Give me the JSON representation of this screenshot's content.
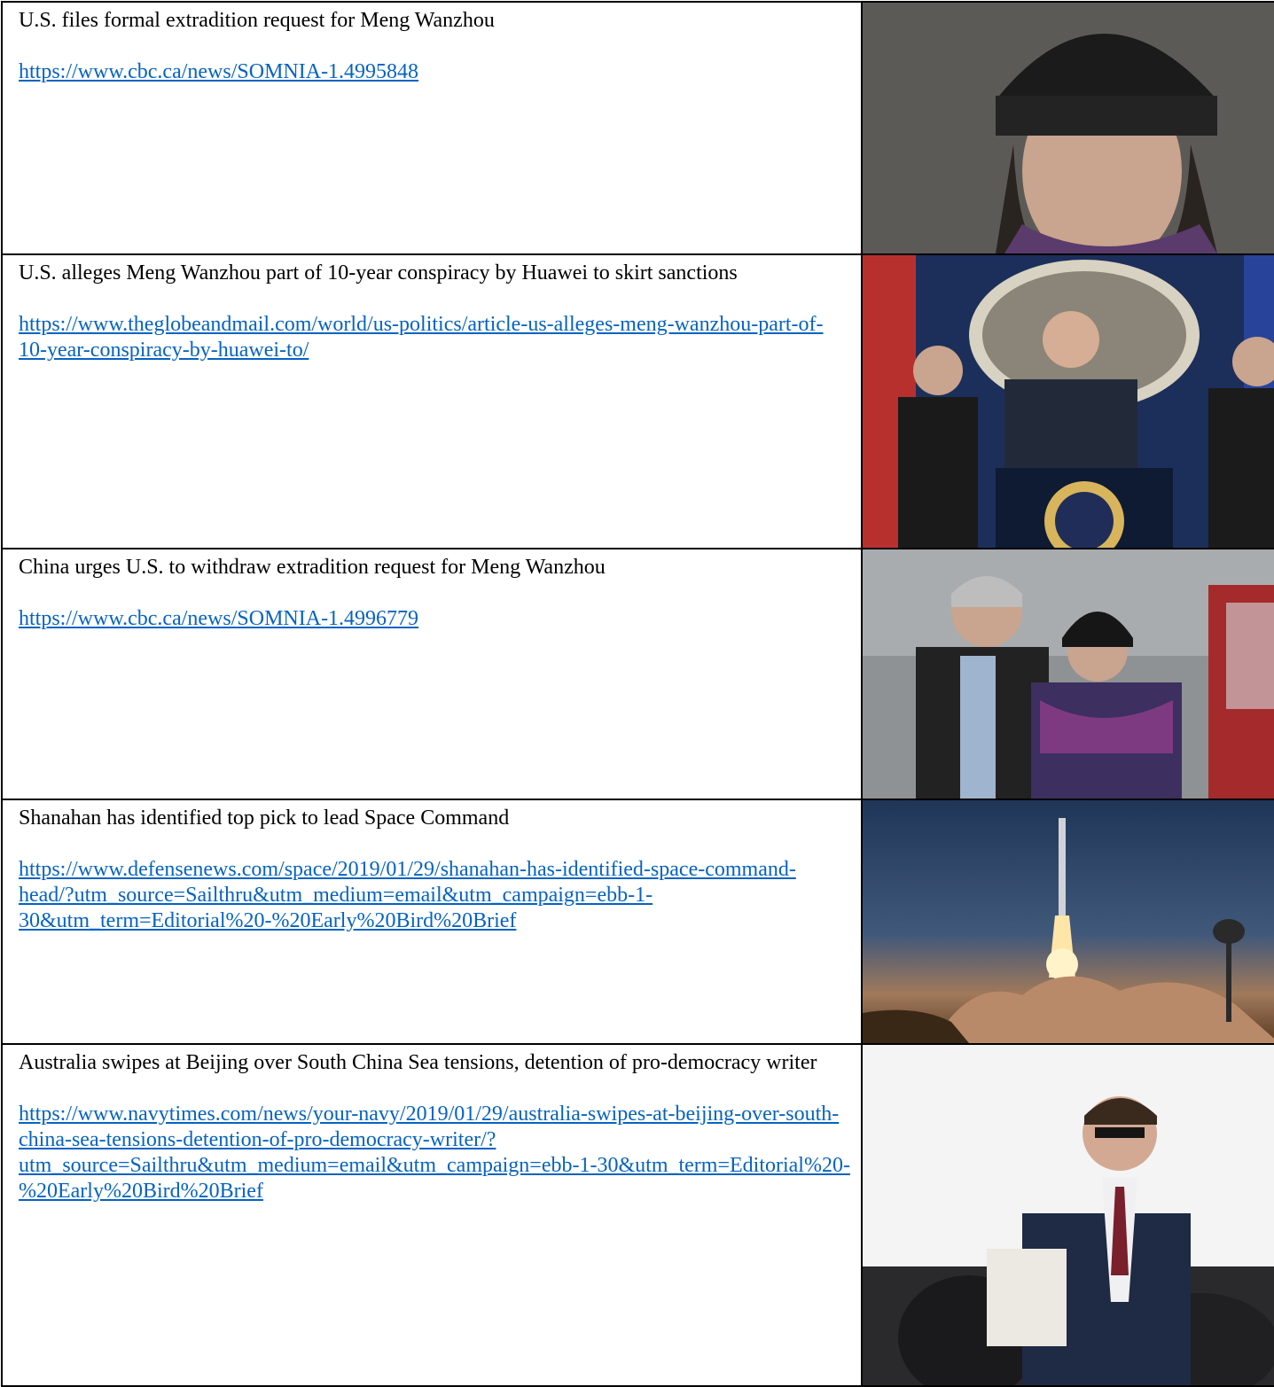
{
  "articles": [
    {
      "headline": "U.S. files formal extradition request for Meng Wanzhou",
      "url": "https://www.cbc.ca/news/SOMNIA-1.4995848",
      "image": "woman-in-knit-hat-photo"
    },
    {
      "headline": "U.S. alleges Meng Wanzhou part of 10-year conspiracy by Huawei to skirt sanctions",
      "url": "https://www.theglobeandmail.com/world/us-politics/article-us-alleges-meng-wanzhou-part-of-10-year-conspiracy-by-huawei-to/",
      "image": "press-conference-photo"
    },
    {
      "headline": "China urges U.S. to withdraw extradition request for Meng Wanzhou",
      "url": "https://www.cbc.ca/news/SOMNIA-1.4996779",
      "image": "escorted-woman-photo"
    },
    {
      "headline": "Shanahan has identified top pick to lead Space Command",
      "url": "https://www.defensenews.com/space/2019/01/29/shanahan-has-identified-space-command-head/?utm_source=Sailthru&utm_medium=email&utm_campaign=ebb-1-30&utm_term=Editorial%20-%20Early%20Bird%20Brief",
      "image": "rocket-launch-photo"
    },
    {
      "headline": "Australia swipes at Beijing over South China Sea tensions, detention of pro-democracy writer",
      "url": "https://www.navytimes.com/news/your-navy/2019/01/29/australia-swipes-at-beijing-over-south-china-sea-tensions-detention-of-pro-democracy-writer/?utm_source=Sailthru&utm_medium=email&utm_campaign=ebb-1-30&utm_term=Editorial%20-%20Early%20Bird%20Brief",
      "image": "speaker-on-stage-photo"
    }
  ],
  "colors": {
    "link": "#0563C1",
    "border": "#000000"
  }
}
